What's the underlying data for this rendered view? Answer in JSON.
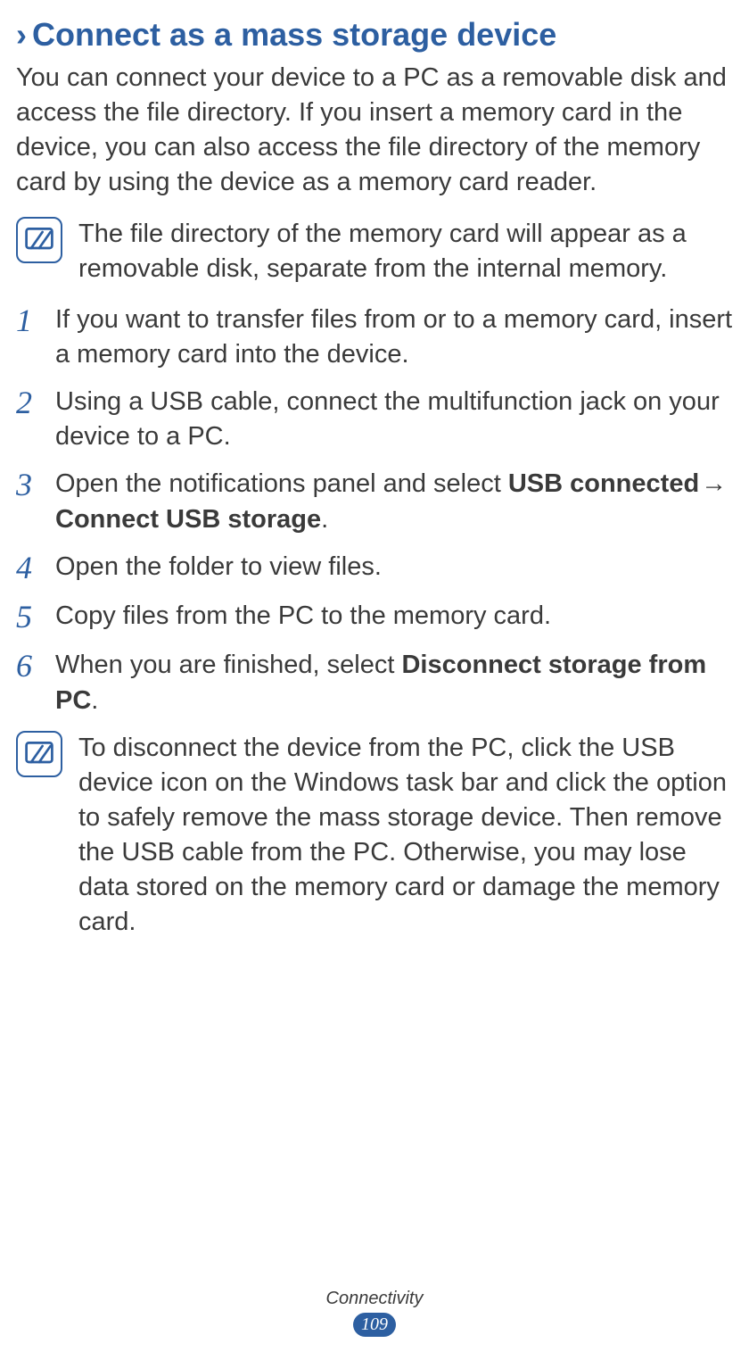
{
  "title": "Connect as a mass storage device",
  "intro": "You can connect your device to a PC as a removable disk and access the file directory. If you insert a memory card in the device, you can also access the file directory of the memory card by using the device as a memory card reader.",
  "note1": "The file directory of the memory card will appear as a removable disk, separate from the internal memory.",
  "steps": {
    "s1": "If you want to transfer files from or to a memory card, insert a memory card into the device.",
    "s2": "Using a USB cable, connect the multifunction jack on your device to a PC.",
    "s3_a": "Open the notifications panel and select ",
    "s3_bold1": "USB connected",
    "s3_arrow": " → ",
    "s3_bold2": "Connect USB storage",
    "s3_end": ".",
    "s4": "Open the folder to view files.",
    "s5": "Copy files from the PC to the memory card.",
    "s6_a": "When you are finished, select ",
    "s6_bold": "Disconnect storage from PC",
    "s6_end": "."
  },
  "note2": "To disconnect the device from the PC, click the USB device icon on the Windows task bar and click the option to safely remove the mass storage device. Then remove the USB cable from the PC. Otherwise, you may lose data stored on the memory card or damage the memory card.",
  "footer_label": "Connectivity",
  "page_number": "109"
}
